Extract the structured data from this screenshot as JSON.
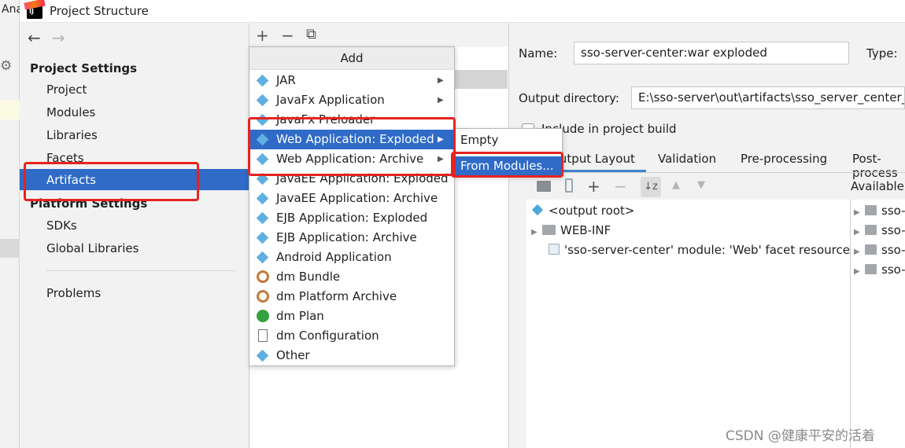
{
  "background": {
    "partial_label": "Ana"
  },
  "window": {
    "title": "Project Structure"
  },
  "nav": {
    "back_icon": "←",
    "forward_icon": "→",
    "project_settings_header": "Project Settings",
    "project_items": [
      "Project",
      "Modules",
      "Libraries",
      "Facets",
      "Artifacts"
    ],
    "selected": "Artifacts",
    "platform_settings_header": "Platform Settings",
    "platform_items": [
      "SDKs",
      "Global Libraries"
    ],
    "problems": "Problems"
  },
  "toolbar": {
    "add_icon": "+",
    "remove_icon": "−",
    "copy_icon": "⧉"
  },
  "add_menu": {
    "header": "Add",
    "items": [
      {
        "label": "JAR",
        "submenu": true,
        "icon": "artifact-icon"
      },
      {
        "label": "JavaFx Application",
        "submenu": true,
        "icon": "artifact-icon"
      },
      {
        "label": "JavaFx Preloader",
        "submenu": false,
        "icon": "artifact-icon"
      },
      {
        "label": "Web Application: Exploded",
        "submenu": true,
        "icon": "web-artifact-icon"
      },
      {
        "label": "Web Application: Archive",
        "submenu": true,
        "icon": "web-artifact-icon"
      },
      {
        "label": "JavaEE Application: Exploded",
        "submenu": false,
        "icon": "javaee-icon"
      },
      {
        "label": "JavaEE Application: Archive",
        "submenu": false,
        "icon": "javaee-icon"
      },
      {
        "label": "EJB Application: Exploded",
        "submenu": false,
        "icon": "ejb-icon"
      },
      {
        "label": "EJB Application: Archive",
        "submenu": false,
        "icon": "ejb-icon"
      },
      {
        "label": "Android Application",
        "submenu": false,
        "icon": "artifact-icon"
      },
      {
        "label": "dm Bundle",
        "submenu": false,
        "icon": "dm-icon"
      },
      {
        "label": "dm Platform Archive",
        "submenu": false,
        "icon": "dm-icon"
      },
      {
        "label": "dm Plan",
        "submenu": false,
        "icon": "plan-icon"
      },
      {
        "label": "dm Configuration",
        "submenu": false,
        "icon": "config-icon"
      },
      {
        "label": "Other",
        "submenu": false,
        "icon": "artifact-icon"
      }
    ],
    "selected_index": 3,
    "submenu_arrow": "▶"
  },
  "sub_menu": {
    "items": [
      "Empty",
      "From Modules..."
    ],
    "selected_index": 1
  },
  "details": {
    "name_label": "Name:",
    "name_value": "sso-server-center:war exploded",
    "type_label": "Type:",
    "output_label": "Output directory:",
    "output_value": "E:\\sso-server\\out\\artifacts\\sso_server_center_w",
    "include_label": "Include in project build",
    "tabs": [
      "Output Layout",
      "Validation",
      "Pre-processing",
      "Post-process"
    ],
    "active_tab": "Output Layout",
    "available_label": "Available Ele",
    "layout_tree": [
      {
        "label": "<output root>",
        "icon": "artifact-icon"
      },
      {
        "label": "WEB-INF",
        "icon": "folder-icon",
        "expander": "▶"
      },
      {
        "label": "'sso-server-center' module: 'Web' facet resources",
        "icon": "web-resources-icon"
      }
    ],
    "available_tree": [
      "sso-cli",
      "sso-cli",
      "sso-se",
      "sso-se"
    ]
  },
  "watermark": "CSDN @健康平安的活着"
}
